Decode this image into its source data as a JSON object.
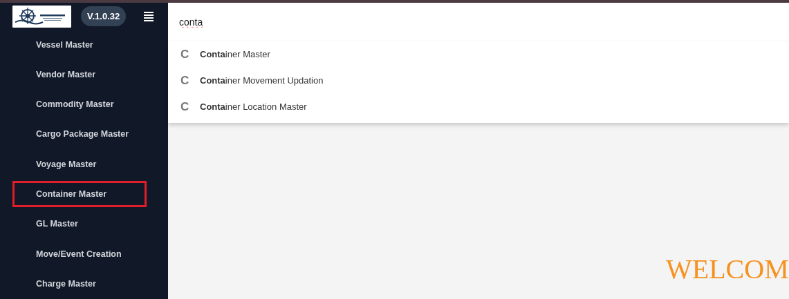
{
  "sidebar": {
    "version": "V.1.0.32",
    "items": [
      {
        "label": "Vessel Master",
        "highlighted": false
      },
      {
        "label": "Vendor Master",
        "highlighted": false
      },
      {
        "label": "Commodity Master",
        "highlighted": false
      },
      {
        "label": "Cargo Package Master",
        "highlighted": false
      },
      {
        "label": "Voyage Master",
        "highlighted": false
      },
      {
        "label": "Container Master",
        "highlighted": true
      },
      {
        "label": "GL Master",
        "highlighted": false
      },
      {
        "label": "Move/Event Creation",
        "highlighted": false
      },
      {
        "label": "Charge Master",
        "highlighted": false
      }
    ]
  },
  "search": {
    "value": "conta",
    "suggestions": [
      {
        "icon": "C",
        "label": "**Conta**iner Master"
      },
      {
        "icon": "C",
        "label": "**Conta**iner Movement Updation"
      },
      {
        "icon": "C",
        "label": "**Conta**iner Location Master"
      }
    ]
  },
  "welcome": "WELCOM"
}
